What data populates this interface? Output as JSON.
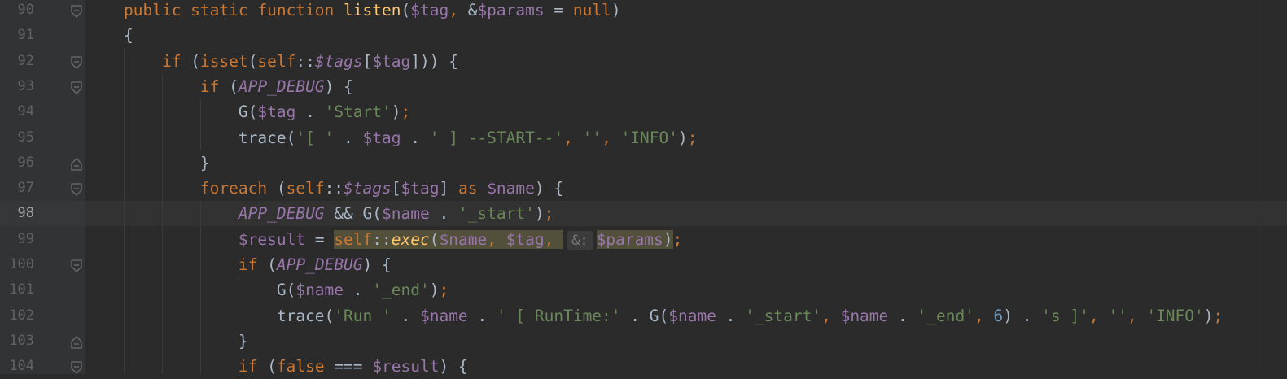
{
  "editor": {
    "lines": [
      {
        "num": "90",
        "fold": "open",
        "tokens": [
          [
            "kw",
            "public static function "
          ],
          [
            "fn",
            "listen"
          ],
          [
            "p",
            "("
          ],
          [
            "var",
            "$tag"
          ],
          [
            "kw",
            ", "
          ],
          [
            "p",
            "&"
          ],
          [
            "var",
            "$params"
          ],
          [
            "p",
            " = "
          ],
          [
            "kw",
            "null"
          ],
          [
            "p",
            ")"
          ]
        ]
      },
      {
        "num": "91",
        "fold": "",
        "tokens": [
          [
            "p",
            "{"
          ]
        ]
      },
      {
        "num": "92",
        "fold": "open",
        "tokens": [
          [
            "p",
            "    "
          ],
          [
            "kw",
            "if "
          ],
          [
            "p",
            "("
          ],
          [
            "kw",
            "isset"
          ],
          [
            "p",
            "("
          ],
          [
            "kw",
            "self"
          ],
          [
            "p",
            "::"
          ],
          [
            "var it",
            "$tags"
          ],
          [
            "p",
            "["
          ],
          [
            "var",
            "$tag"
          ],
          [
            "p",
            "])) {"
          ]
        ]
      },
      {
        "num": "93",
        "fold": "open",
        "tokens": [
          [
            "p",
            "        "
          ],
          [
            "kw",
            "if "
          ],
          [
            "p",
            "("
          ],
          [
            "const",
            "APP_DEBUG"
          ],
          [
            "p",
            ") {"
          ]
        ]
      },
      {
        "num": "94",
        "fold": "",
        "tokens": [
          [
            "p",
            "            G("
          ],
          [
            "var",
            "$tag"
          ],
          [
            "p",
            " . "
          ],
          [
            "str",
            "'Start'"
          ],
          [
            "p",
            ")"
          ],
          [
            "kw",
            ";"
          ]
        ]
      },
      {
        "num": "95",
        "fold": "",
        "tokens": [
          [
            "p",
            "            trace("
          ],
          [
            "str",
            "'[ '"
          ],
          [
            "p",
            " . "
          ],
          [
            "var",
            "$tag"
          ],
          [
            "p",
            " . "
          ],
          [
            "str",
            "' ] --START--'"
          ],
          [
            "kw",
            ", "
          ],
          [
            "str",
            "''"
          ],
          [
            "kw",
            ", "
          ],
          [
            "str",
            "'INFO'"
          ],
          [
            "p",
            ")"
          ],
          [
            "kw",
            ";"
          ]
        ]
      },
      {
        "num": "96",
        "fold": "close",
        "tokens": [
          [
            "p",
            "        }"
          ]
        ]
      },
      {
        "num": "97",
        "fold": "open",
        "tokens": [
          [
            "p",
            "        "
          ],
          [
            "kw",
            "foreach "
          ],
          [
            "p",
            "("
          ],
          [
            "kw",
            "self"
          ],
          [
            "p",
            "::"
          ],
          [
            "var it",
            "$tags"
          ],
          [
            "p",
            "["
          ],
          [
            "var",
            "$tag"
          ],
          [
            "p",
            "] "
          ],
          [
            "kw",
            "as "
          ],
          [
            "var",
            "$name"
          ],
          [
            "p",
            ") {"
          ]
        ]
      },
      {
        "num": "98",
        "fold": "",
        "current": true,
        "tokens": [
          [
            "p",
            "            "
          ],
          [
            "const",
            "APP_DEBUG"
          ],
          [
            "p",
            " && G("
          ],
          [
            "var",
            "$name"
          ],
          [
            "p",
            " . "
          ],
          [
            "str",
            "'_start'"
          ],
          [
            "p",
            ")"
          ],
          [
            "kw",
            ";"
          ]
        ]
      },
      {
        "num": "99",
        "fold": "",
        "tokens": [
          [
            "p",
            "            "
          ],
          [
            "var",
            "$result"
          ],
          [
            "p",
            " = "
          ],
          [
            "kw hl",
            "self"
          ],
          [
            "p hl",
            "::"
          ],
          [
            "fn it hl",
            "exec"
          ],
          [
            "p hl",
            "("
          ],
          [
            "var hl",
            "$name"
          ],
          [
            "kw hl",
            ", "
          ],
          [
            "var hl",
            "$tag"
          ],
          [
            "kw hl",
            ", "
          ],
          [
            "hint hl",
            "&:"
          ],
          [
            "var hl",
            "$params"
          ],
          [
            "p hl",
            ")"
          ],
          [
            "kw",
            ";"
          ]
        ]
      },
      {
        "num": "100",
        "fold": "open",
        "tokens": [
          [
            "p",
            "            "
          ],
          [
            "kw",
            "if "
          ],
          [
            "p",
            "("
          ],
          [
            "const",
            "APP_DEBUG"
          ],
          [
            "p",
            ") {"
          ]
        ]
      },
      {
        "num": "101",
        "fold": "",
        "tokens": [
          [
            "p",
            "                G("
          ],
          [
            "var",
            "$name"
          ],
          [
            "p",
            " . "
          ],
          [
            "str",
            "'_end'"
          ],
          [
            "p",
            ")"
          ],
          [
            "kw",
            ";"
          ]
        ]
      },
      {
        "num": "102",
        "fold": "",
        "tokens": [
          [
            "p",
            "                trace("
          ],
          [
            "str",
            "'Run '"
          ],
          [
            "p",
            " . "
          ],
          [
            "var",
            "$name"
          ],
          [
            "p",
            " . "
          ],
          [
            "str",
            "' [ RunTime:'"
          ],
          [
            "p",
            " . G("
          ],
          [
            "var",
            "$name"
          ],
          [
            "p",
            " . "
          ],
          [
            "str",
            "'_start'"
          ],
          [
            "kw",
            ", "
          ],
          [
            "var",
            "$name"
          ],
          [
            "p",
            " . "
          ],
          [
            "str",
            "'_end'"
          ],
          [
            "kw",
            ", "
          ],
          [
            "num",
            "6"
          ],
          [
            "p",
            ") . "
          ],
          [
            "str",
            "'s ]'"
          ],
          [
            "kw",
            ", "
          ],
          [
            "str",
            "''"
          ],
          [
            "kw",
            ", "
          ],
          [
            "str",
            "'INFO'"
          ],
          [
            "p",
            ")"
          ],
          [
            "kw",
            ";"
          ]
        ]
      },
      {
        "num": "103",
        "fold": "close",
        "tokens": [
          [
            "p",
            "            }"
          ]
        ]
      },
      {
        "num": "104",
        "fold": "open",
        "tokens": [
          [
            "p",
            "            "
          ],
          [
            "kw",
            "if "
          ],
          [
            "p",
            "("
          ],
          [
            "kw",
            "false"
          ],
          [
            "p",
            " === "
          ],
          [
            "var",
            "$result"
          ],
          [
            "p",
            ") {"
          ]
        ]
      }
    ]
  },
  "colors": {
    "background": "#2b2b2b",
    "gutter": "#313335",
    "keyword": "#cc7832",
    "function": "#ffc66d",
    "variable": "#9876aa",
    "string": "#6a8759",
    "number": "#6897bb",
    "plain": "#a9b7c6",
    "highlight": "#52503a"
  }
}
